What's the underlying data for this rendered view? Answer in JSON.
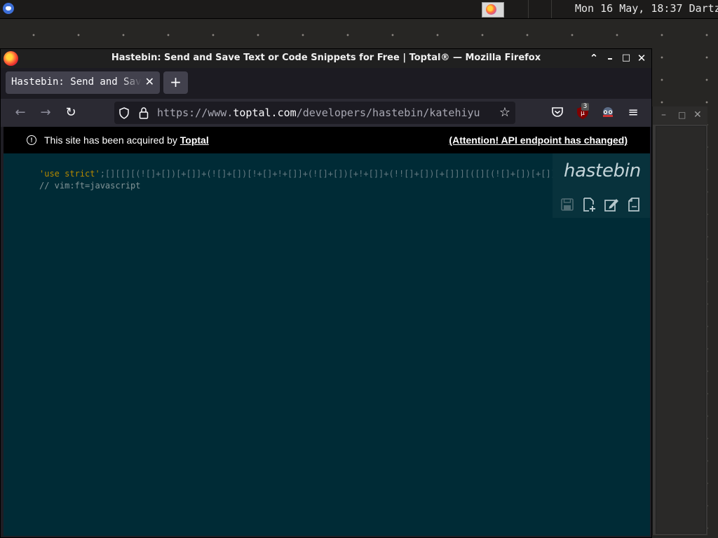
{
  "panel": {
    "clock": "Mon 16 May, 18:37",
    "user": "Dartz"
  },
  "window": {
    "title": "Hastebin: Send and Save Text or Code Snippets for Free | Toptal® — Mozilla Firefox"
  },
  "tabs": [
    {
      "label": "Hastebin: Send and Save Text or Code Snippets for Free | Toptal®",
      "active": true
    }
  ],
  "navbar": {
    "url_scheme": "https://www.",
    "url_host": "toptal.com",
    "url_path": "/developers/hastebin/katehiyu",
    "extension_badge": "3"
  },
  "banner": {
    "prefix": "This site has been acquired by ",
    "link": "Toptal",
    "api_notice": "(Attention! API endpoint has changed)"
  },
  "editor": {
    "line1_string": "'use strict'",
    "line1_code": ";[][[][(![]+[])[+[]]+(![]+[])[!+[]+!+[]]+(![]+[])[+!+[]]+(!![]+[])[+[]]][([][(![]+[])[+[]]+(![]+[])[!+[]+!+[]]+(![]+[])[+!+[]]+(!![]+[])[+[]]]+[])[!+[]+!+[]+!+[]]",
    "line2": "// vim:ft=javascript"
  },
  "brand": {
    "logo": "hastebin"
  },
  "colors": {
    "editor_bg": "#002b36",
    "string": "#b58900",
    "code_text": "#839496"
  }
}
